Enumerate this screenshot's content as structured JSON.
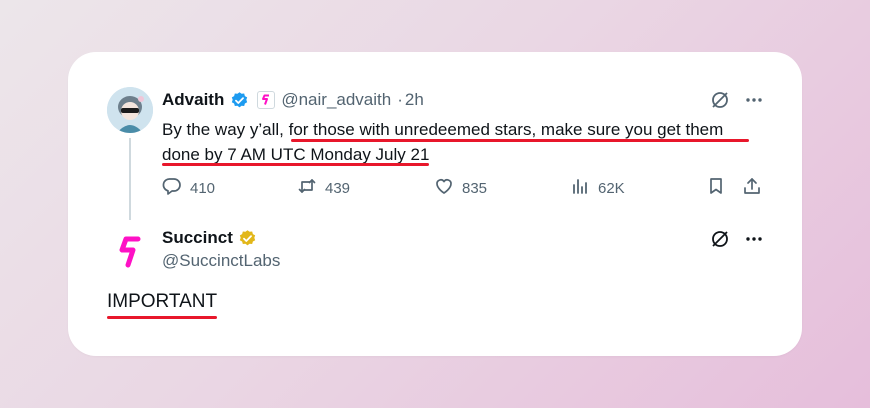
{
  "tweet": {
    "author_name": "Advaith",
    "handle": "@nair_advaith",
    "separator": "·",
    "time": "2h",
    "text_part1": "By the way y’all, ",
    "text_part2": "for those with unredeemed stars, make sure you get them",
    "text_line2": "done by 7 AM UTC Monday July 21",
    "stats": {
      "replies": "410",
      "reposts": "439",
      "likes": "835",
      "views": "62K"
    }
  },
  "quoted": {
    "author_name": "Succinct",
    "handle": "@SuccinctLabs",
    "text": "IMPORTANT"
  },
  "colors": {
    "verified_blue": "#1d9bf0",
    "verified_gold": "#e2b719",
    "brand_pink": "#fe11c5",
    "underline_red": "#e8172b"
  },
  "icons": [
    "verified-blue-icon",
    "succinct-logo-icon",
    "grok-icon",
    "more-icon",
    "reply-icon",
    "repost-icon",
    "like-icon",
    "views-icon",
    "bookmark-icon",
    "share-icon",
    "verified-gold-icon"
  ]
}
